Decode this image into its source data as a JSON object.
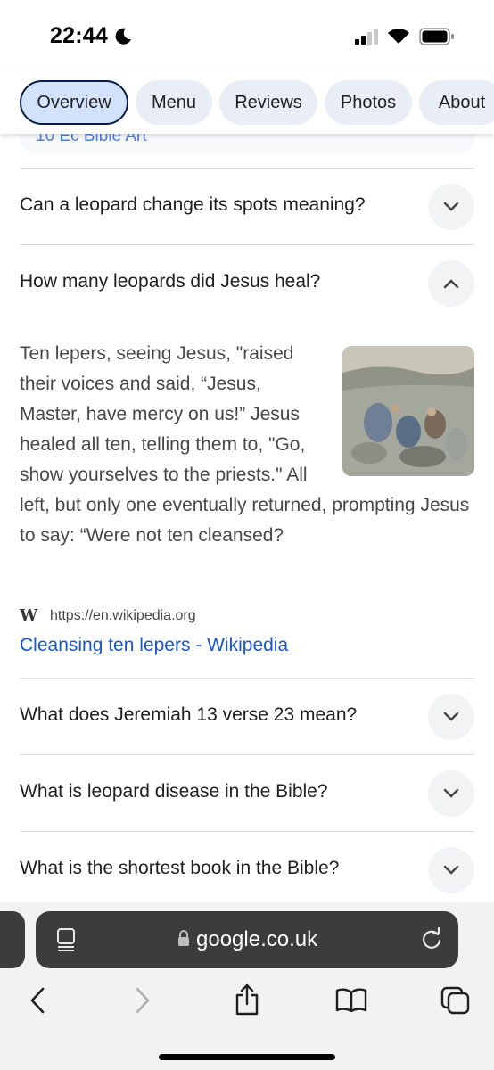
{
  "status_bar": {
    "time": "22:44"
  },
  "chips": [
    {
      "label": "Overview",
      "active": true
    },
    {
      "label": "Menu",
      "active": false
    },
    {
      "label": "Reviews",
      "active": false
    },
    {
      "label": "Photos",
      "active": false
    },
    {
      "label": "About",
      "active": false
    }
  ],
  "peek_text": "10 Ec Bible Art",
  "faq": [
    {
      "question": "Can a leopard change its spots meaning?",
      "expanded": false
    },
    {
      "question": "How many leopards did Jesus heal?",
      "expanded": true
    },
    {
      "question": "What does Jeremiah 13 verse 23 mean?",
      "expanded": false
    },
    {
      "question": "What is leopard disease in the Bible?",
      "expanded": false
    },
    {
      "question": "What is the shortest book in the Bible?",
      "expanded": false
    }
  ],
  "answer": {
    "text": "Ten lepers, seeing Jesus, \"raised their voices and said, “Jesus, Master, have mercy on us!” Jesus healed all ten, telling them to, \"Go, show yourselves to the priests.\" All left, but only one eventually returned, prompting Jesus to say: “Were not ten cleansed?",
    "source_icon": "W",
    "source_url": "https://en.wikipedia.org",
    "source_title": "Cleansing ten lepers - Wikipedia"
  },
  "browser": {
    "domain": "google.co.uk"
  },
  "colors": {
    "chip_bg": "#e9eef6",
    "chip_active_bg": "#d3e3fd",
    "link": "#1a57c9",
    "address_bar": "#3c3c3c"
  }
}
